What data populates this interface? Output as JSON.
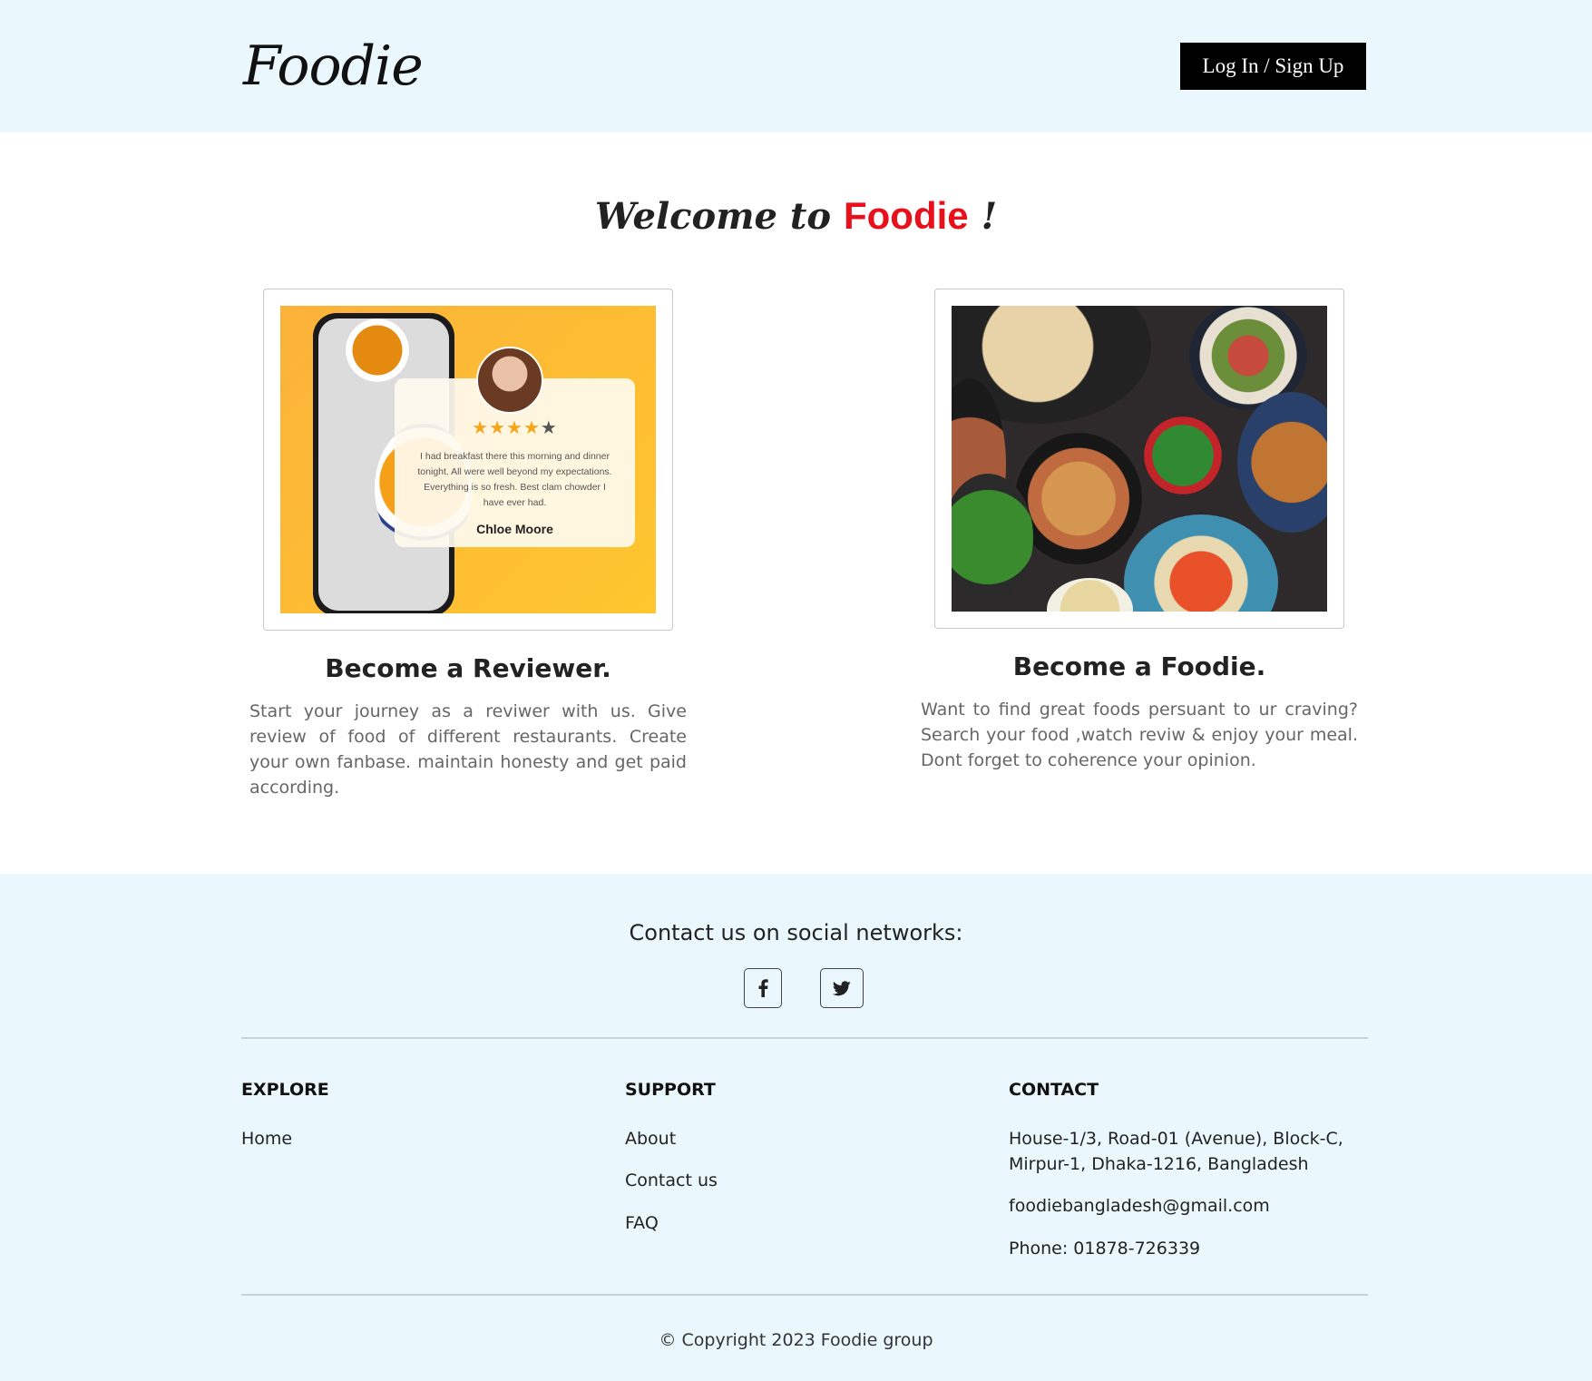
{
  "header": {
    "logo": "Foodie",
    "login_label": "Log In / Sign Up"
  },
  "welcome": {
    "prefix": "Welcome to ",
    "brand": "Foodie",
    "suffix": " !"
  },
  "cards": [
    {
      "title": "Become a Reviewer.",
      "description": "Start your journey as a reviwer with us. Give review of food of different restaurants. Create your own fanbase. maintain honesty and get paid according.",
      "image": {
        "review_text": "I had breakfast there this morning and dinner tonight. All were well beyond my expectations. Everything is so fresh. Best clam chowder I have ever had.",
        "reviewer_name": "Chloe Moore",
        "rating": 4,
        "rating_max": 5
      }
    },
    {
      "title": "Become a Foodie.",
      "description": "Want to find great foods persuant to ur craving? Search your food ,watch reviw & enjoy your meal. Dont forget to coherence your opinion."
    }
  ],
  "footer": {
    "contact_title": "Contact us on social networks:",
    "social": [
      "facebook-icon",
      "twitter-icon"
    ],
    "explore": {
      "title": "EXPLORE",
      "links": [
        "Home"
      ]
    },
    "support": {
      "title": "SUPPORT",
      "links": [
        "About",
        "Contact us",
        "FAQ"
      ]
    },
    "contact": {
      "title": "CONTACT",
      "address_line1": "House-1/3, Road-01 (Avenue), Block-C,",
      "address_line2": "Mirpur-1, Dhaka-1216, Bangladesh",
      "email": "foodiebangladesh@gmail.com",
      "phone": "Phone: 01878-726339"
    },
    "copyright": "© Copyright 2023 Foodie group"
  },
  "colors": {
    "header_bg": "#eaf8fd",
    "brand_red": "#e8111b",
    "button_bg": "#000000"
  }
}
